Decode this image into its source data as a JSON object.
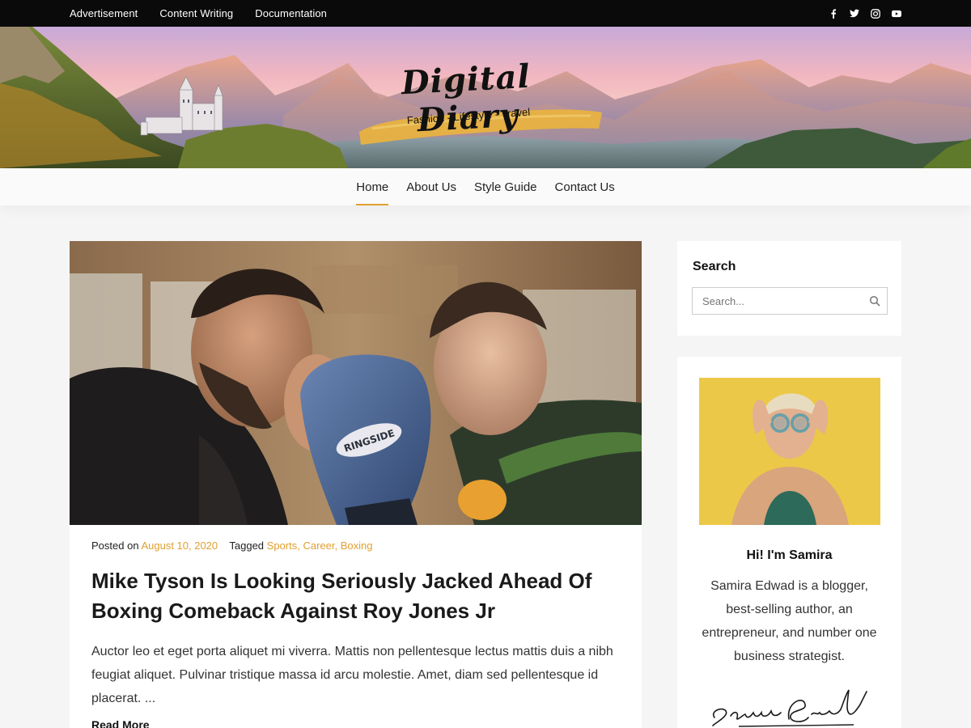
{
  "topbar": {
    "links": [
      "Advertisement",
      "Content Writing",
      "Documentation"
    ],
    "social_icons": [
      "facebook-icon",
      "twitter-icon",
      "instagram-icon",
      "youtube-icon"
    ]
  },
  "header": {
    "site_title": "Digital Diary",
    "tagline": "Fashion - Lifestyle - Travel"
  },
  "nav": {
    "items": [
      "Home",
      "About Us",
      "Style Guide",
      "Contact Us"
    ],
    "active": "Home"
  },
  "post": {
    "posted_on_label": "Posted on",
    "date": "August 10, 2020",
    "tagged_label": "Tagged",
    "tags": "Sports, Career, Boxing",
    "title": "Mike Tyson Is Looking Seriously Jacked Ahead Of Boxing Comeback Against Roy Jones Jr",
    "excerpt": "Auctor leo et eget porta aliquet mi viverra. Mattis non pellentesque lectus mattis duis a nibh feugiat aliquet. Pulvinar tristique massa id arcu molestie. Amet, diam sed pellentesque id placerat. ...",
    "read_more": "Read More",
    "glove_brand": "RINGSIDE"
  },
  "sidebar": {
    "search": {
      "title": "Search",
      "placeholder": "Search..."
    },
    "about": {
      "heading": "Hi! I'm Samira",
      "text": "Samira Edwad is a blogger, best-selling author, an entrepreneur, and number one business strategist.",
      "signature": "Samira Edward"
    }
  },
  "colors": {
    "accent": "#e0a030",
    "topbar_bg": "#0a0a0a"
  }
}
